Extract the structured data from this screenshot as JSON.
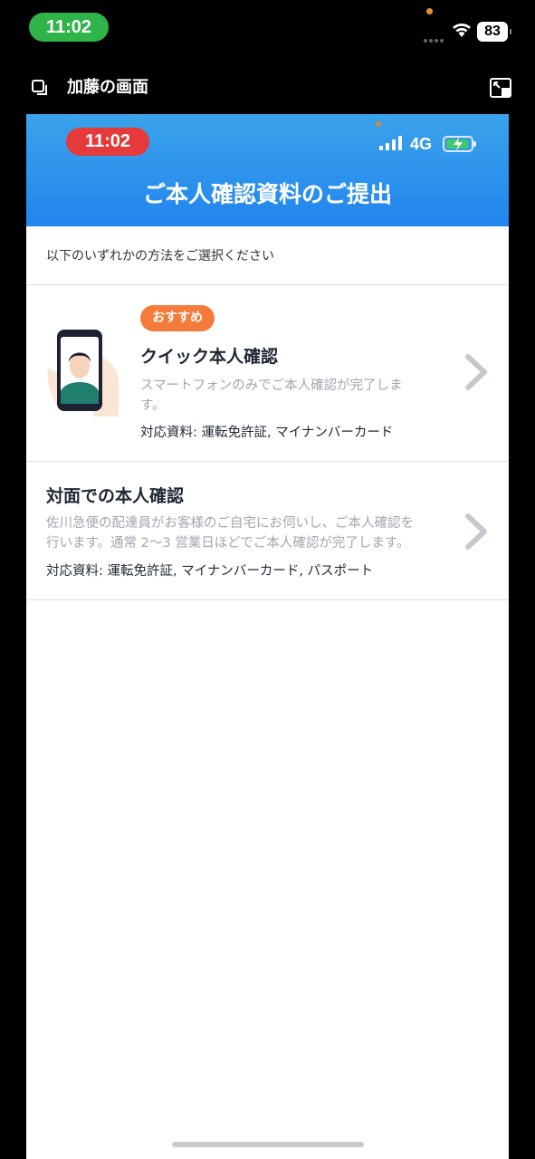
{
  "outer_status": {
    "time": "11:02",
    "battery": "83"
  },
  "share_bar": {
    "title": "加藤の画面"
  },
  "inner_status": {
    "time": "11:02",
    "network": "4G"
  },
  "header": {
    "title": "ご本人確認資料のご提出"
  },
  "instruction": "以下のいずれかの方法をご選択ください",
  "options": [
    {
      "badge": "おすすめ",
      "title": "クイック本人確認",
      "desc_line1": "スマートフォンのみでご本人確認が完了しま",
      "desc_line2": "す。",
      "docs": "対応資料: 運転免許証, マイナンバーカード"
    },
    {
      "title": "対面での本人確認",
      "desc_line1": "佐川急便の配達員がお客様のご自宅にお伺いし、ご本人確認を",
      "desc_line2": "行います。通常 2～3 営業日ほどでご本人確認が完了します。",
      "docs": "対応資料: 運転免許証, マイナンバーカード, パスポート"
    }
  ],
  "colors": {
    "header_blue": "#2285ee",
    "badge_orange": "#f57b3a",
    "time_green": "#2fb44a",
    "time_red": "#e63a3a"
  }
}
